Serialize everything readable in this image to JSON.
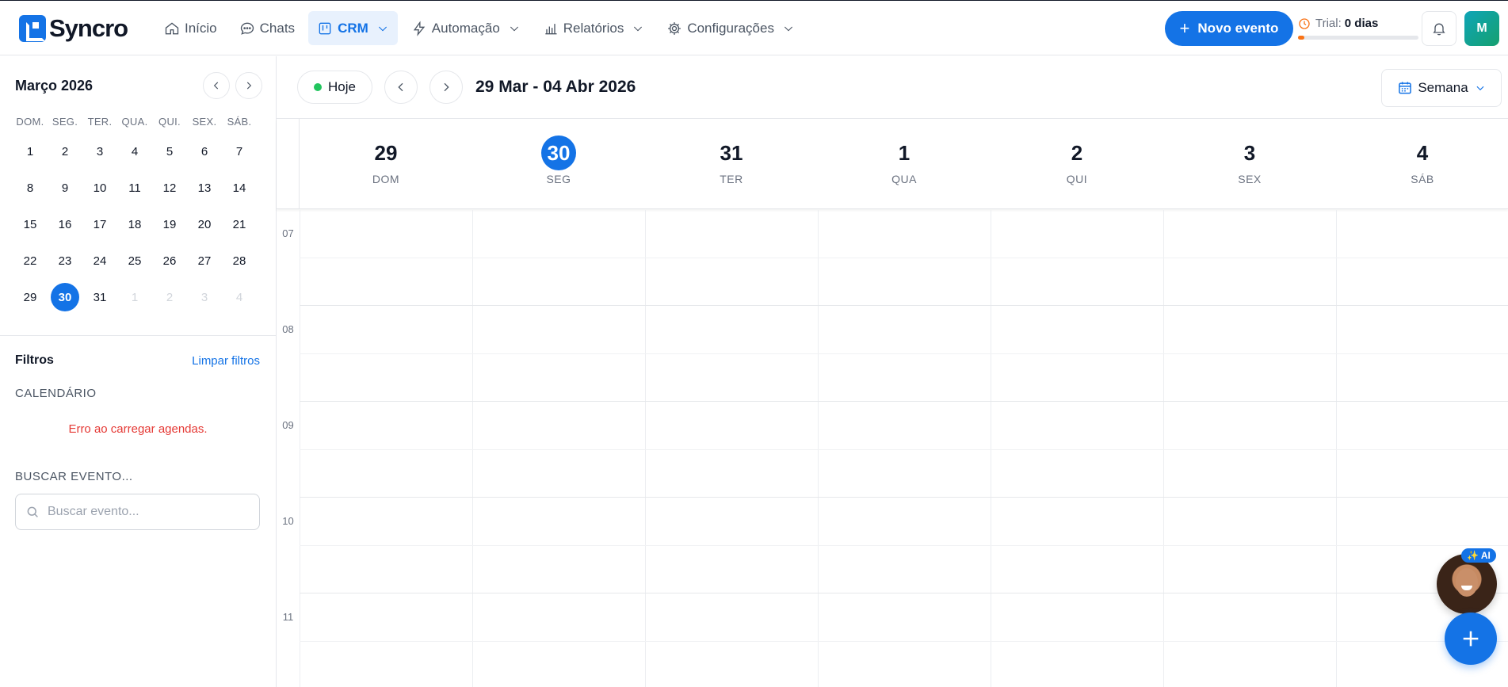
{
  "brand": {
    "name": "Syncro"
  },
  "nav": {
    "items": [
      {
        "label": "Início",
        "icon": "home-icon",
        "dropdown": false,
        "active": false
      },
      {
        "label": "Chats",
        "icon": "chat-icon",
        "dropdown": false,
        "active": false
      },
      {
        "label": "CRM",
        "icon": "kanban-icon",
        "dropdown": true,
        "active": true
      },
      {
        "label": "Automação",
        "icon": "bolt-icon",
        "dropdown": true,
        "active": false
      },
      {
        "label": "Relatórios",
        "icon": "bar-chart-icon",
        "dropdown": true,
        "active": false
      },
      {
        "label": "Configurações",
        "icon": "gear-icon",
        "dropdown": true,
        "active": false
      }
    ]
  },
  "header": {
    "new_event_label": "Novo evento",
    "trial_label": "Trial:",
    "trial_value": "0 dias",
    "trial_progress": 0.05,
    "avatar_initial": "M"
  },
  "sidebar": {
    "month_title": "Março 2026",
    "weekdays": [
      "DOM.",
      "SEG.",
      "TER.",
      "QUA.",
      "QUI.",
      "SEX.",
      "SÁB."
    ],
    "weeks": [
      [
        {
          "d": "1"
        },
        {
          "d": "2"
        },
        {
          "d": "3"
        },
        {
          "d": "4"
        },
        {
          "d": "5"
        },
        {
          "d": "6"
        },
        {
          "d": "7"
        }
      ],
      [
        {
          "d": "8"
        },
        {
          "d": "9"
        },
        {
          "d": "10"
        },
        {
          "d": "11"
        },
        {
          "d": "12"
        },
        {
          "d": "13"
        },
        {
          "d": "14"
        }
      ],
      [
        {
          "d": "15"
        },
        {
          "d": "16"
        },
        {
          "d": "17"
        },
        {
          "d": "18"
        },
        {
          "d": "19"
        },
        {
          "d": "20"
        },
        {
          "d": "21"
        }
      ],
      [
        {
          "d": "22"
        },
        {
          "d": "23"
        },
        {
          "d": "24"
        },
        {
          "d": "25"
        },
        {
          "d": "26"
        },
        {
          "d": "27"
        },
        {
          "d": "28"
        }
      ],
      [
        {
          "d": "29"
        },
        {
          "d": "30",
          "selected": true
        },
        {
          "d": "31"
        },
        {
          "d": "1",
          "muted": true
        },
        {
          "d": "2",
          "muted": true
        },
        {
          "d": "3",
          "muted": true
        },
        {
          "d": "4",
          "muted": true
        }
      ]
    ],
    "filters_title": "Filtros",
    "clear_filters": "Limpar filtros",
    "calendar_label": "CALENDÁRIO",
    "calendar_error": "Erro ao carregar agendas.",
    "search_label": "BUSCAR EVENTO...",
    "search_placeholder": "Buscar evento..."
  },
  "main": {
    "today_label": "Hoje",
    "range_title": "29 Mar - 04 Abr 2026",
    "view_label": "Semana",
    "days": [
      {
        "num": "29",
        "name": "DOM",
        "today": false
      },
      {
        "num": "30",
        "name": "SEG",
        "today": true
      },
      {
        "num": "31",
        "name": "TER",
        "today": false
      },
      {
        "num": "1",
        "name": "QUA",
        "today": false
      },
      {
        "num": "2",
        "name": "QUI",
        "today": false
      },
      {
        "num": "3",
        "name": "SEX",
        "today": false
      },
      {
        "num": "4",
        "name": "SÁB",
        "today": false
      }
    ],
    "hours": [
      "07",
      "08",
      "09",
      "10",
      "11"
    ]
  },
  "assistant": {
    "badge": "✨ AI"
  },
  "colors": {
    "accent": "#1473e6",
    "error": "#e53935",
    "today_dot": "#22c55e",
    "trial": "#f97316"
  }
}
